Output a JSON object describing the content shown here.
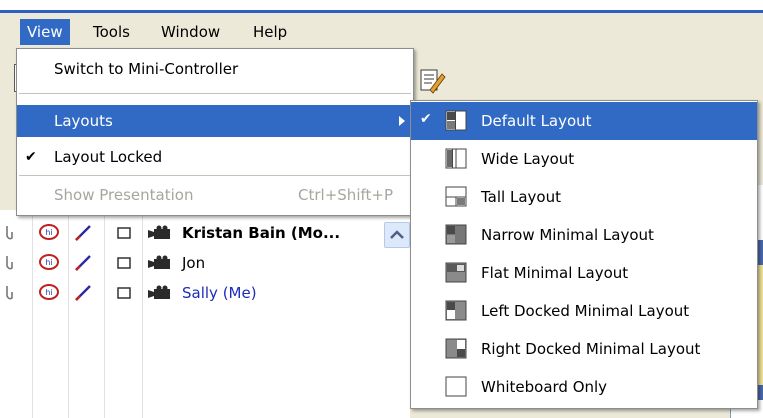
{
  "menubar": {
    "items": [
      {
        "label": "View",
        "active": true
      },
      {
        "label": "Tools"
      },
      {
        "label": "Window"
      },
      {
        "label": "Help"
      }
    ]
  },
  "view_menu": {
    "switch_mini": "Switch to Mini-Controller",
    "layouts": "Layouts",
    "layout_locked": "Layout Locked",
    "layout_locked_checked": true,
    "show_presentation": "Show Presentation",
    "show_presentation_shortcut": "Ctrl+Shift+P",
    "show_presentation_enabled": false
  },
  "layouts_submenu": {
    "items": [
      {
        "label": "Default Layout",
        "checked": true,
        "icon": "default-layout-icon"
      },
      {
        "label": "Wide Layout",
        "icon": "wide-layout-icon"
      },
      {
        "label": "Tall Layout",
        "icon": "tall-layout-icon"
      },
      {
        "label": "Narrow Minimal Layout",
        "icon": "narrow-minimal-layout-icon"
      },
      {
        "label": "Flat Minimal Layout",
        "icon": "flat-minimal-layout-icon"
      },
      {
        "label": "Left Docked Minimal Layout",
        "icon": "left-docked-minimal-layout-icon"
      },
      {
        "label": "Right Docked Minimal Layout",
        "icon": "right-docked-minimal-layout-icon"
      },
      {
        "label": "Whiteboard Only",
        "icon": "whiteboard-only-icon"
      }
    ]
  },
  "participants": [
    {
      "name": "Kristan Bain (Mo...",
      "style": "bold"
    },
    {
      "name": "Jon",
      "style": "normal"
    },
    {
      "name": "Sally (Me)",
      "style": "self"
    }
  ],
  "colors": {
    "highlight": "#316ac5",
    "self_name": "#1d2bb8",
    "menu_bg": "#ece9d8"
  }
}
